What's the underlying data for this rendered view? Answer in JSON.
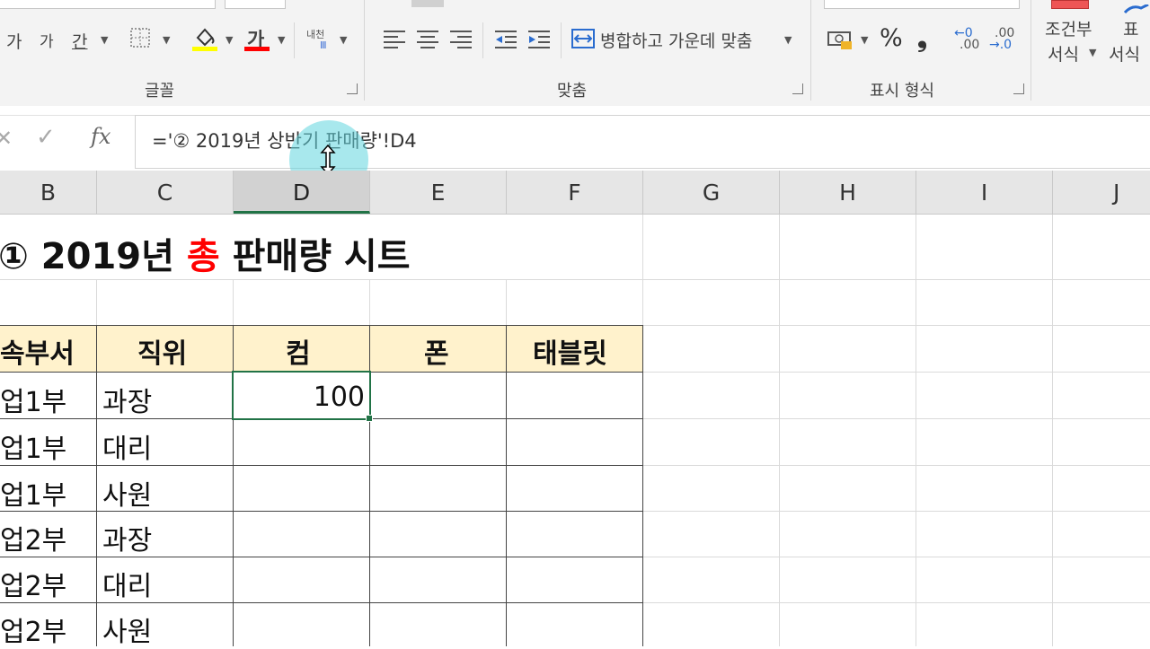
{
  "ribbon": {
    "font_buttons": [
      "가",
      "가",
      "간"
    ],
    "fill_color": "#FFFF00",
    "font_color_letter": "가",
    "font_color": "#FF0000",
    "phonetic_top": "내천",
    "merge_label": "병합하고 가운데 맞춤",
    "percent": "%",
    "comma": "❟",
    "dec_increase_top": "←0",
    "dec_increase_bottom": ".00",
    "dec_decrease_top": ".00",
    "dec_decrease_bottom": "→.0",
    "conditional_line1": "조건부",
    "conditional_line2": "서식",
    "table_line1": "표",
    "table_line2": "서식",
    "group_font": "글꼴",
    "group_align": "맞춤",
    "group_number": "표시 형식"
  },
  "formula_bar": {
    "cancel": "✕",
    "enter": "✓",
    "fx": "fx",
    "formula": "='② 2019년 상반기 판매량'!D4"
  },
  "columns": [
    "B",
    "C",
    "D",
    "E",
    "F",
    "G",
    "H",
    "I",
    "J"
  ],
  "sheet": {
    "title_prefix": "① 2019년 ",
    "title_highlight": "총",
    "title_suffix": " 판매량 시트",
    "title_highlight_color": "#FF0000",
    "header_fill": "#FFF2CC",
    "headers": [
      "속부서",
      "직위",
      "컴",
      "폰",
      "태블릿"
    ],
    "rows": [
      {
        "dept": "업1부",
        "position": "과장",
        "computer": "100",
        "phone": "",
        "tablet": ""
      },
      {
        "dept": "업1부",
        "position": "대리",
        "computer": "",
        "phone": "",
        "tablet": ""
      },
      {
        "dept": "업1부",
        "position": "사원",
        "computer": "",
        "phone": "",
        "tablet": ""
      },
      {
        "dept": "업2부",
        "position": "과장",
        "computer": "",
        "phone": "",
        "tablet": ""
      },
      {
        "dept": "업2부",
        "position": "대리",
        "computer": "",
        "phone": "",
        "tablet": ""
      },
      {
        "dept": "업2부",
        "position": "사원",
        "computer": "",
        "phone": "",
        "tablet": ""
      }
    ]
  }
}
